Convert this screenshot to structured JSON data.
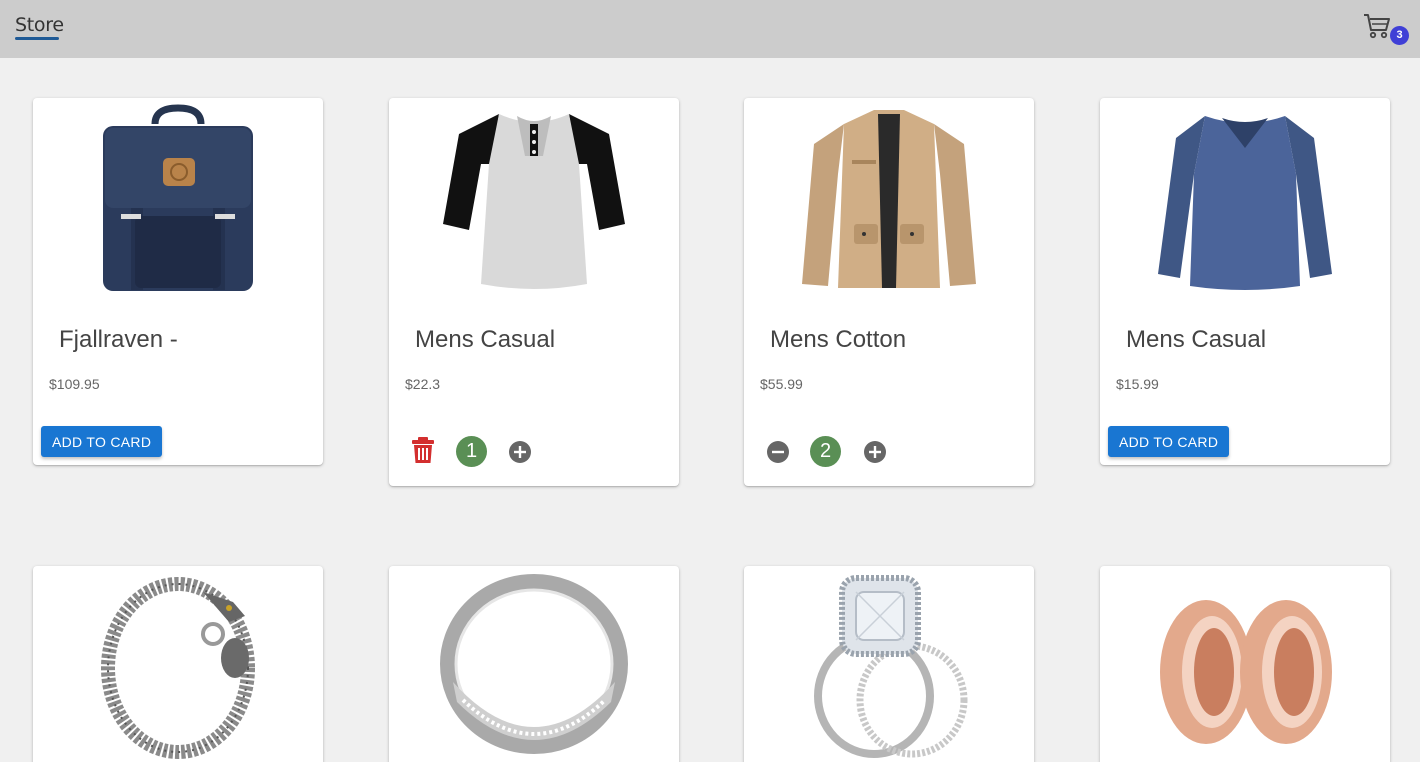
{
  "navbar": {
    "brand": "Store",
    "cart_icon": "shopping-cart-icon",
    "cart_count": "3",
    "badge_color": "#3f3fd6"
  },
  "products": [
    {
      "title": "Fjallraven -",
      "price": "$109.95",
      "button_label": "ADD TO CARD",
      "image": "backpack"
    },
    {
      "title": "Mens Casual",
      "price": "$22.3",
      "quantity": "1",
      "image": "raglan-tshirt"
    },
    {
      "title": "Mens Cotton",
      "price": "$55.99",
      "quantity": "2",
      "image": "jacket"
    },
    {
      "title": "Mens Casual",
      "price": "$15.99",
      "button_label": "ADD TO CARD",
      "image": "longsleeve-shirt"
    },
    {
      "image": "dragon-bracelet"
    },
    {
      "image": "silver-ring"
    },
    {
      "image": "diamond-ring-set"
    },
    {
      "image": "rose-gold-plugs"
    }
  ],
  "colors": {
    "primary": "#1976d2",
    "quantity": "#5a8f55",
    "delete": "#d32f2f",
    "navbar": "#cccccc"
  }
}
